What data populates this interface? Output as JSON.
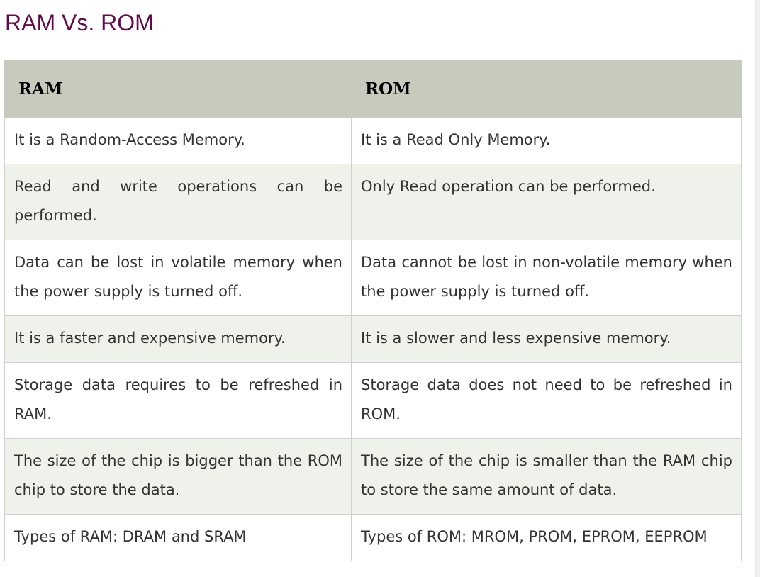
{
  "title": "RAM Vs. ROM",
  "table": {
    "headers": [
      "RAM",
      "ROM"
    ],
    "rows": [
      [
        "It is a Random-Access Memory.",
        "It is a Read Only Memory."
      ],
      [
        "Read and write operations can be performed.",
        "Only Read operation can be performed."
      ],
      [
        "Data can be lost in volatile memory when the power supply is turned off.",
        "Data cannot be lost in non-volatile memory when the power supply is turned off."
      ],
      [
        "It is a faster and expensive memory.",
        "It is a slower and less expensive memory."
      ],
      [
        "Storage data requires to be refreshed in RAM.",
        "Storage data does not need to be refreshed in ROM."
      ],
      [
        "The size of the chip is bigger than the ROM chip to store the data.",
        "The size of the chip is smaller than the RAM chip to store the same amount of data."
      ],
      [
        "Types of RAM: DRAM and SRAM",
        "Types of ROM: MROM, PROM, EPROM, EEPROM"
      ]
    ]
  },
  "colors": {
    "title": "#610b4b",
    "header_background": "#c7cbbd",
    "stripe_background": "#eff1eb",
    "cell_text": "#333333"
  }
}
